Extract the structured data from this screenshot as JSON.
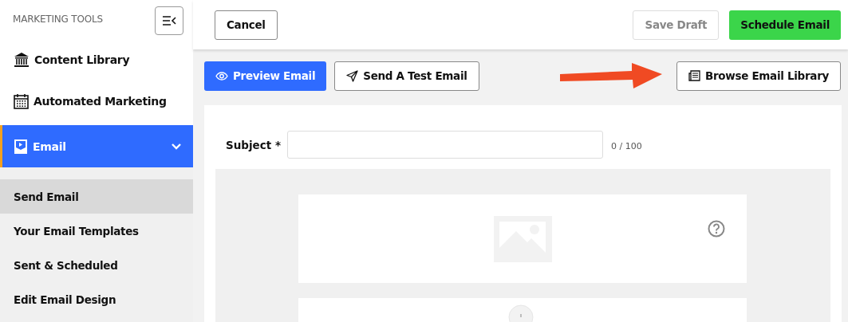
{
  "sidebar": {
    "title": "MARKETING TOOLS",
    "items": [
      {
        "label": "Content Library",
        "selected": false
      },
      {
        "label": "Automated Marketing",
        "selected": false
      },
      {
        "label": "Email",
        "selected": true,
        "expanded": true,
        "children": [
          {
            "label": "Send Email",
            "selected": true
          },
          {
            "label": "Your Email Templates",
            "selected": false
          },
          {
            "label": "Sent & Scheduled",
            "selected": false
          },
          {
            "label": "Edit Email Design",
            "selected": false
          }
        ]
      }
    ]
  },
  "top_bar": {
    "cancel": "Cancel",
    "save_draft": {
      "label": "Save Draft",
      "disabled": true
    },
    "schedule": {
      "label": "Schedule Email",
      "disabled": false
    }
  },
  "toolbar": {
    "preview": "Preview Email",
    "send_test": "Send A Test Email",
    "browse": "Browse Email Library"
  },
  "subject": {
    "label": "Subject *",
    "counter": "0 / 100"
  }
}
